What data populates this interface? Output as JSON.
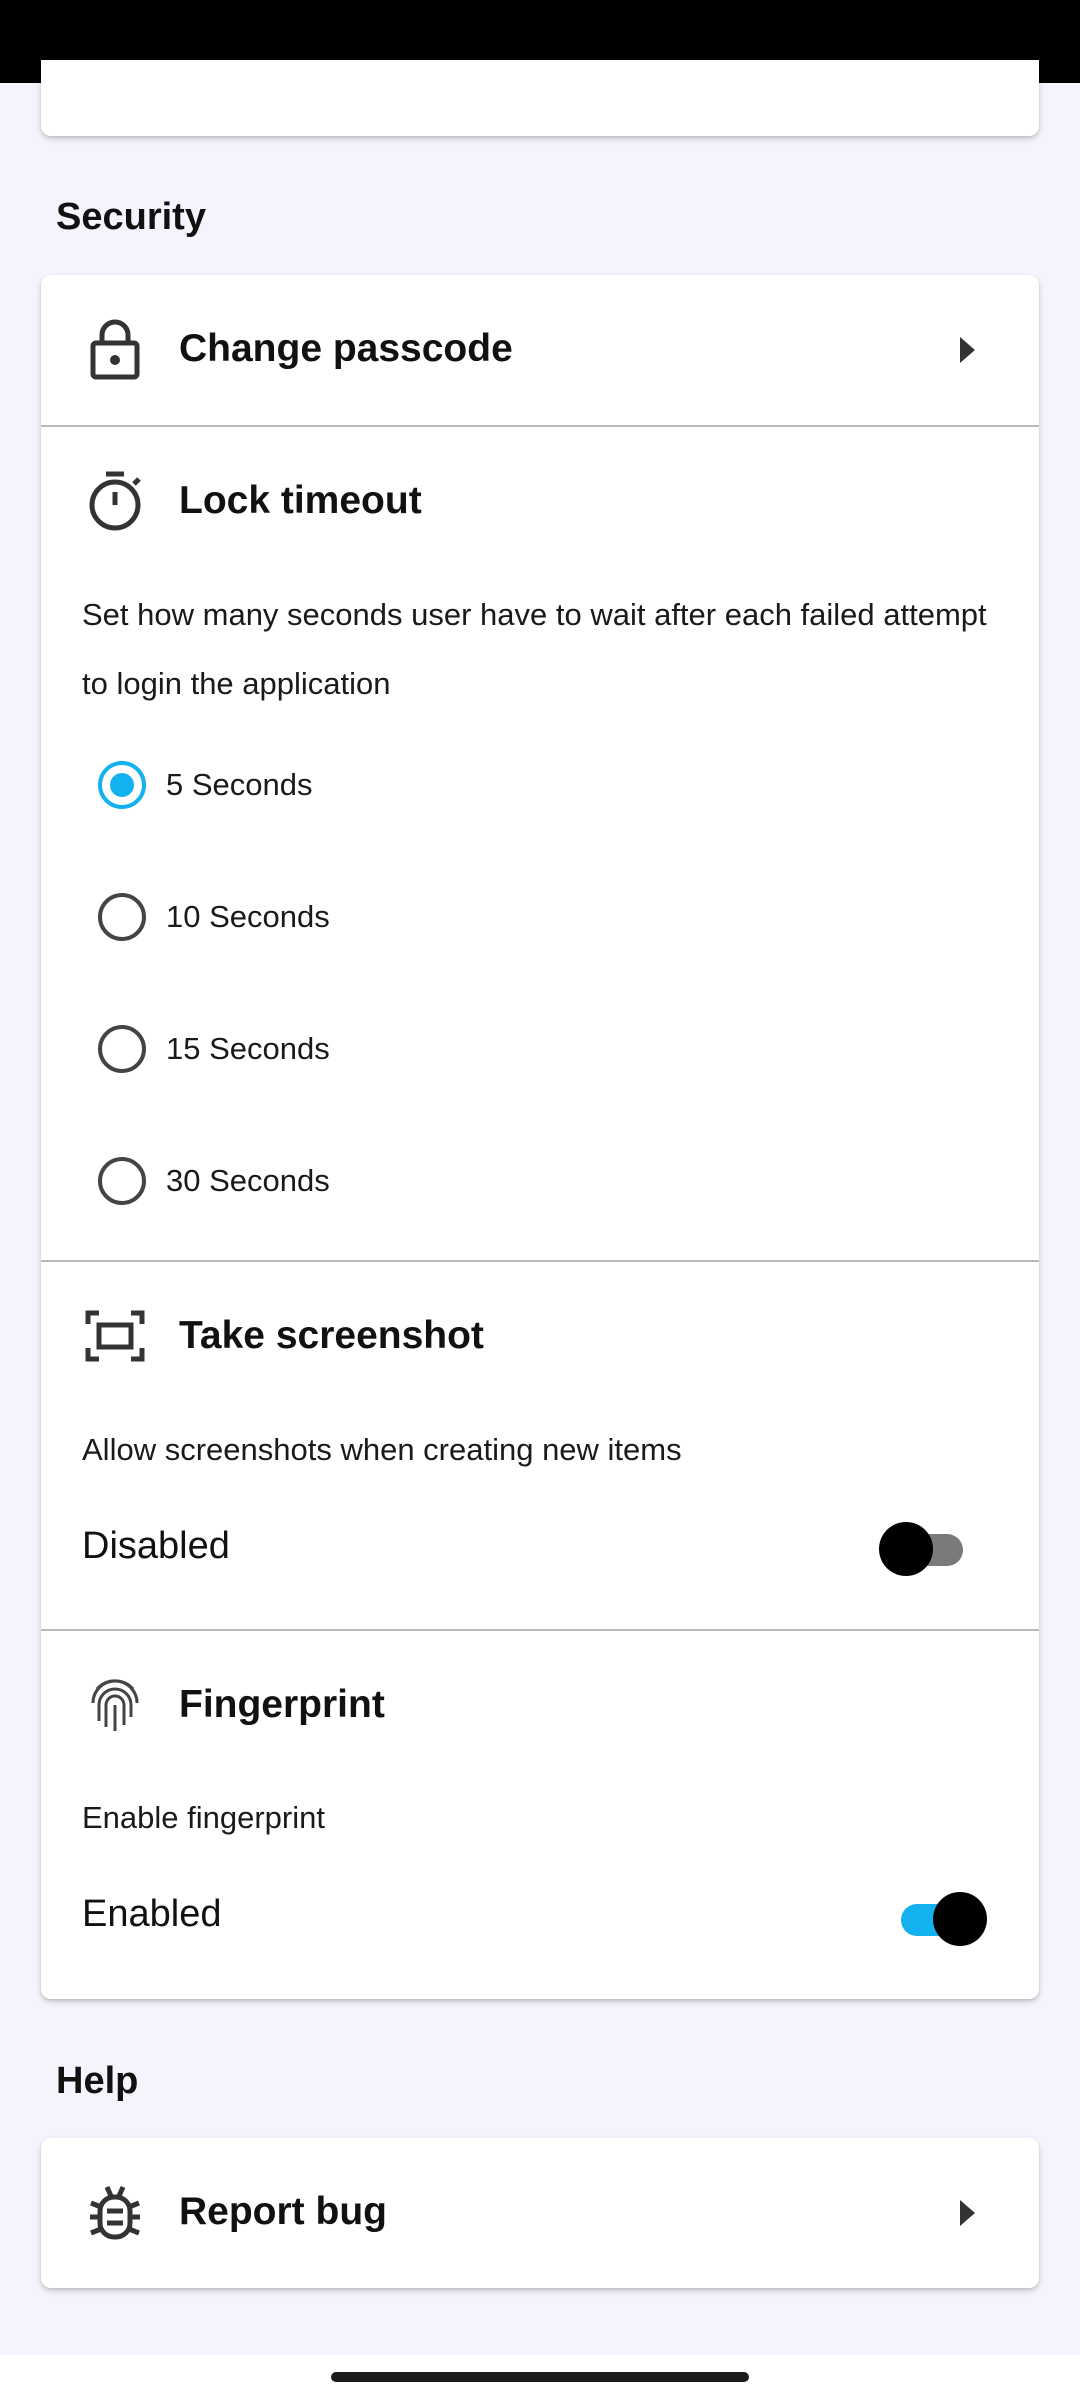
{
  "sections": {
    "security_title": "Security",
    "help_title": "Help"
  },
  "security": {
    "change_passcode": "Change passcode",
    "lock_timeout": {
      "title": "Lock timeout",
      "description": "Set how many seconds user have to wait after each failed attempt to login the application",
      "options": [
        "5 Seconds",
        "10 Seconds",
        "15 Seconds",
        "30 Seconds"
      ],
      "selected": "5 Seconds"
    },
    "screenshot": {
      "title": "Take screenshot",
      "description": "Allow screenshots when creating new items",
      "state_label": "Disabled",
      "enabled": false
    },
    "fingerprint": {
      "title": "Fingerprint",
      "description": "Enable fingerprint",
      "state_label": "Enabled",
      "enabled": true
    }
  },
  "help": {
    "report_bug": "Report bug"
  },
  "colors": {
    "accent": "#14b1f0",
    "background": "#f5f3fb",
    "card": "#ffffff"
  },
  "icons": [
    "lock-icon",
    "timer-icon",
    "screenshot-icon",
    "fingerprint-icon",
    "bug-icon",
    "chevron-right-icon"
  ]
}
